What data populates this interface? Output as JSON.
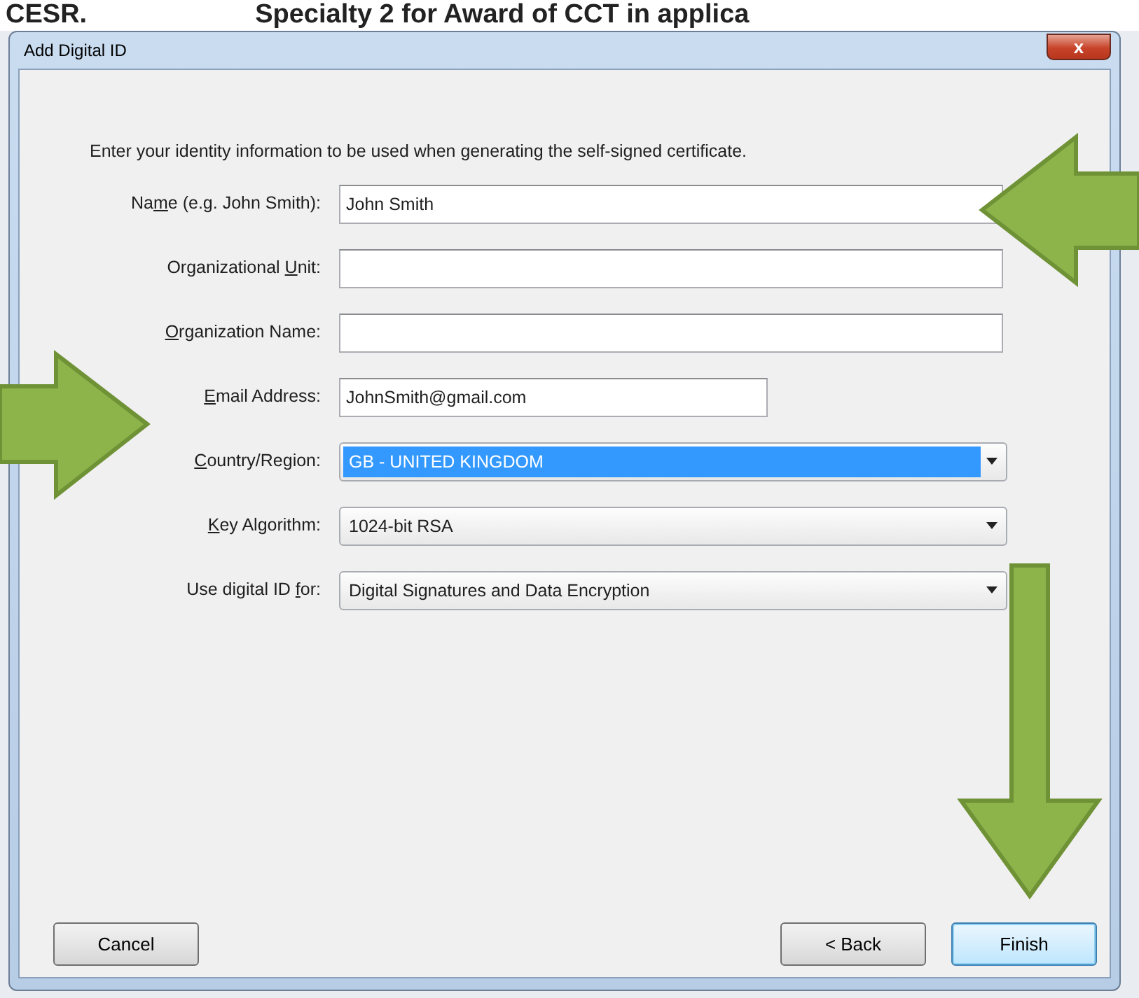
{
  "background": {
    "texts": [
      "CESR.",
      "Specialty 2 for Award of CCT in applica"
    ]
  },
  "window": {
    "title": "Add Digital ID",
    "close": "x"
  },
  "intro": "Enter your identity information to be used when generating the self-signed certificate.",
  "fields": [
    {
      "kind": "text",
      "label": {
        "before": "Na",
        "key": "m",
        "after": "e (e.g. John Smith):"
      },
      "value": "John Smith"
    },
    {
      "kind": "text",
      "label": {
        "before": "Organizational ",
        "key": "U",
        "after": "nit:"
      }
    },
    {
      "kind": "text",
      "label": {
        "key": "O",
        "after": "rganization Name:"
      }
    },
    {
      "kind": "short_text",
      "label": {
        "key": "E",
        "after": "mail Address:"
      },
      "value": "JohnSmith@gmail.com"
    },
    {
      "kind": "select",
      "label": {
        "key": "C",
        "after": "ountry/Region:"
      },
      "value": "GB - UNITED KINGDOM",
      "highlighted": true
    },
    {
      "kind": "select",
      "label": {
        "key": "K",
        "after": "ey Algorithm:"
      },
      "value": "1024-bit RSA",
      "highlighted": false
    },
    {
      "kind": "select",
      "label": {
        "before": "Use digital ID ",
        "key": "f",
        "after": "or:"
      },
      "value": "Digital Signatures and Data Encryption",
      "highlighted": false
    }
  ],
  "buttons": [
    {
      "label": "Cancel",
      "default": false
    },
    {
      "label": "< Back",
      "default": false
    },
    {
      "label": "Finish",
      "default": true
    }
  ]
}
